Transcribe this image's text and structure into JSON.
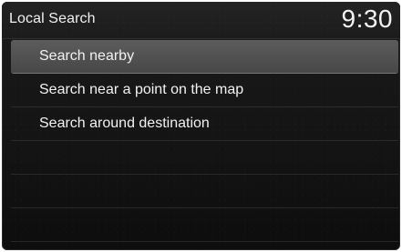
{
  "header": {
    "title": "Local Search",
    "clock": "9:30"
  },
  "menu": {
    "items": [
      {
        "label": "Search nearby",
        "selected": true
      },
      {
        "label": "Search near a point on the map",
        "selected": false
      },
      {
        "label": "Search around destination",
        "selected": false
      },
      {
        "label": "",
        "selected": false
      },
      {
        "label": "",
        "selected": false
      },
      {
        "label": "",
        "selected": false
      }
    ]
  },
  "colors": {
    "background": "#141414",
    "header": "#1f1f1f",
    "selected_row": "#515151",
    "text": "#f2f2f2"
  }
}
